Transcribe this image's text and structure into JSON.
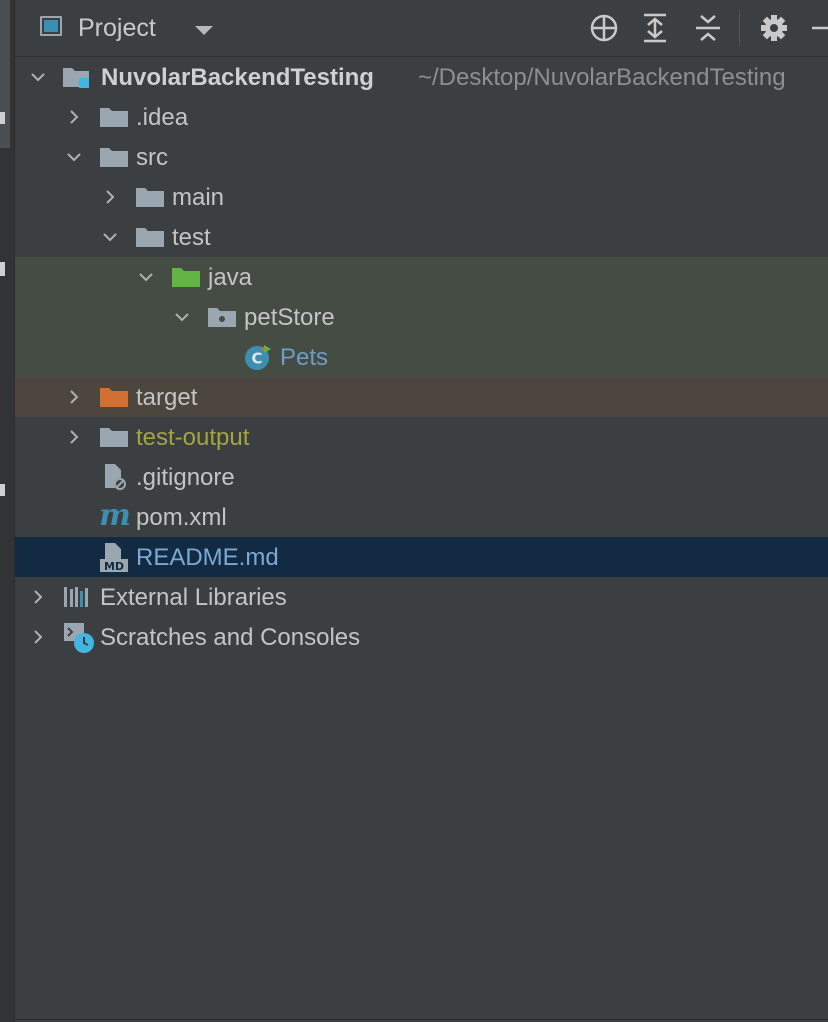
{
  "header": {
    "title": "Project"
  },
  "tree": {
    "root": {
      "label": "NuvolarBackendTesting",
      "path": "~/Desktop/NuvolarBackendTesting"
    },
    "idea": {
      "label": ".idea"
    },
    "src": {
      "label": "src"
    },
    "main": {
      "label": "main"
    },
    "test": {
      "label": "test"
    },
    "java": {
      "label": "java"
    },
    "petstore": {
      "label": "petStore"
    },
    "pets": {
      "label": "Pets",
      "badge": "C"
    },
    "target": {
      "label": "target"
    },
    "test_output": {
      "label": "test-output"
    },
    "gitignore": {
      "label": ".gitignore"
    },
    "pom": {
      "label": "pom.xml",
      "icon_glyph": "m"
    },
    "readme": {
      "label": "README.md",
      "icon_text": "MD"
    },
    "external": {
      "label": "External Libraries"
    },
    "scratches": {
      "label": "Scratches and Consoles"
    }
  },
  "colors": {
    "background": "#3c3f41",
    "folder": "#9aa7b0",
    "source_folder": "#62b543",
    "excluded_folder": "#d26f32",
    "selection": "#132a43"
  }
}
